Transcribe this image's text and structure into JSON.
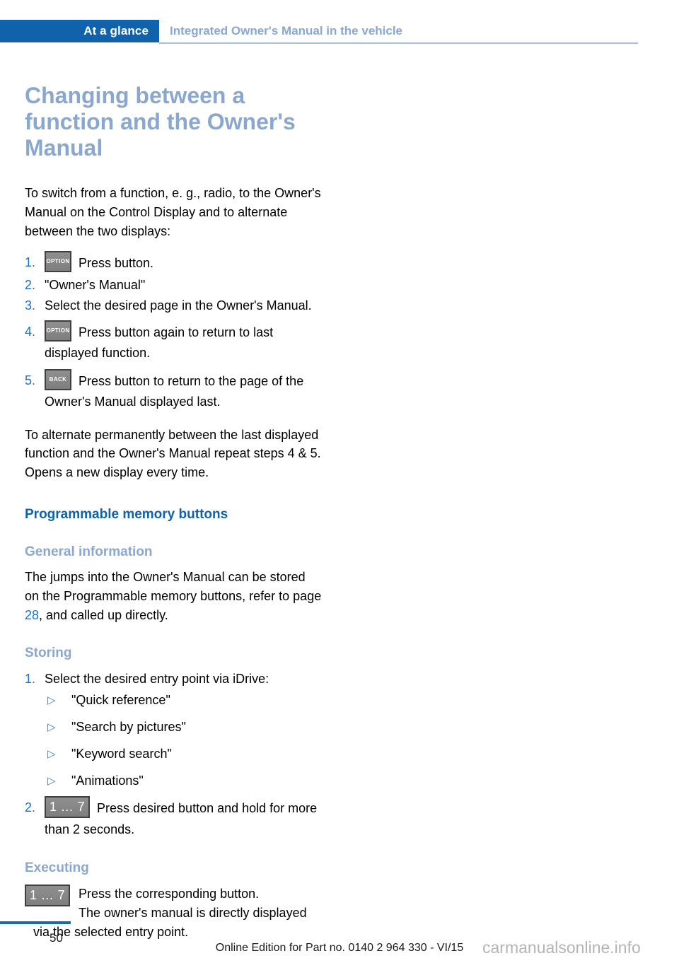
{
  "header": {
    "tab_label": "At a glance",
    "chapter_title": "Integrated Owner's Manual in the vehicle"
  },
  "sections": {
    "changing": {
      "title": "Changing between a function and the Owner's Manual",
      "intro": "To switch from a function, e. g., radio, to the Owner's Manual on the Control Display and to alternate between the two displays:",
      "steps": [
        {
          "num": "1.",
          "button": "OPTION",
          "text": "Press button."
        },
        {
          "num": "2.",
          "button": "",
          "text": "\"Owner's Manual\""
        },
        {
          "num": "3.",
          "button": "",
          "text": "Select the desired page in the Owner's Manual."
        },
        {
          "num": "4.",
          "button": "OPTION",
          "text": "Press button again to return to last displayed function."
        },
        {
          "num": "5.",
          "button": "BACK",
          "text": "Press button to return to the page of the Owner's Manual displayed last."
        }
      ],
      "outro": "To alternate permanently between the last displayed function and the Owner's Manual repeat steps 4 & 5. Opens a new display every time."
    },
    "memory_buttons": {
      "title": "Programmable memory buttons",
      "general": {
        "title": "General information",
        "text_before_ref": "The jumps into the Owner's Manual can be stored on the Programmable memory buttons, refer to page ",
        "page_ref": "28",
        "text_after_ref": ", and called up directly."
      },
      "storing": {
        "title": "Storing",
        "steps": [
          {
            "num": "1.",
            "text": "Select the desired entry point via iDrive:"
          }
        ],
        "options": [
          {
            "bullet": "▷",
            "label": "\"Quick reference\""
          },
          {
            "bullet": "▷",
            "label": "\"Search by pictures\""
          },
          {
            "bullet": "▷",
            "label": "\"Keyword search\""
          },
          {
            "bullet": "▷",
            "label": "\"Animations\""
          }
        ],
        "step2": {
          "num": "2.",
          "button": "1 … 7",
          "text": "Press desired button and hold for more than 2 seconds."
        }
      },
      "executing": {
        "title": "Executing",
        "button": "1 … 7",
        "line1": "Press the corresponding button.",
        "line2": "The owner's manual is directly displayed via the selected entry point."
      }
    }
  },
  "footer": {
    "page_number": "50",
    "edition_text": "Online Edition for Part no. 0140 2 964 330 - VI/15",
    "watermark": "carmanualsonline.info"
  }
}
